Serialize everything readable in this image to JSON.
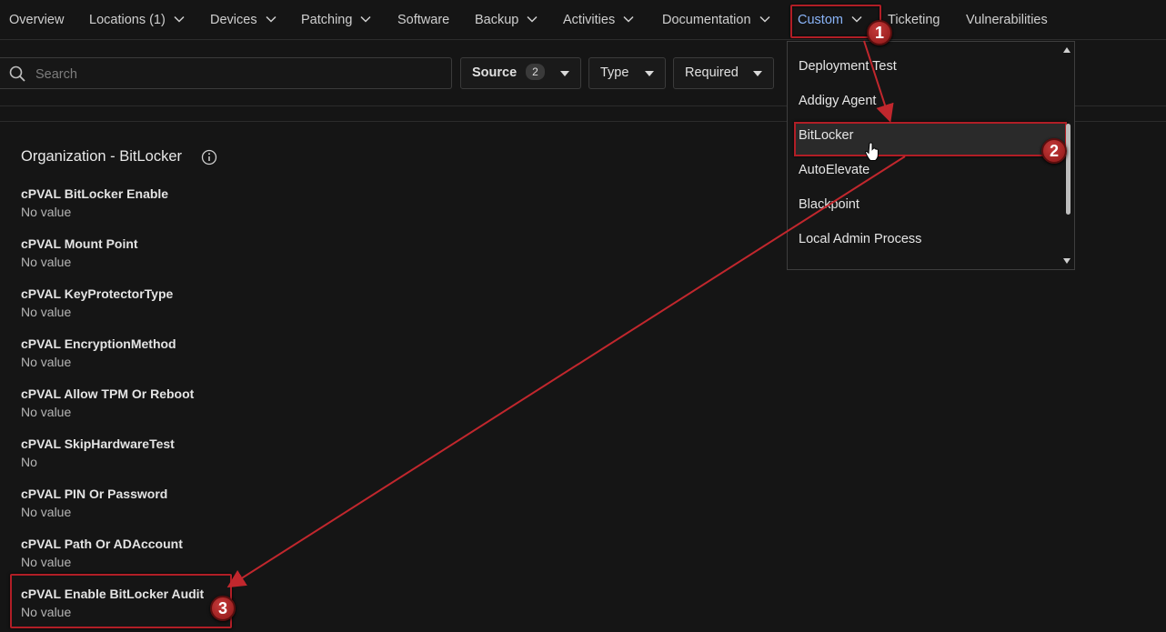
{
  "nav": {
    "items": [
      {
        "label": "Overview",
        "chevron": false
      },
      {
        "label": "Locations (1)",
        "chevron": true
      },
      {
        "label": "Devices",
        "chevron": true
      },
      {
        "label": "Patching",
        "chevron": true
      },
      {
        "label": "Software",
        "chevron": false
      },
      {
        "label": "Backup",
        "chevron": true
      },
      {
        "label": "Activities",
        "chevron": true
      },
      {
        "label": "Documentation",
        "chevron": true
      },
      {
        "label": "Custom",
        "chevron": true,
        "active": true
      },
      {
        "label": "Ticketing",
        "chevron": false
      },
      {
        "label": "Vulnerabilities",
        "chevron": false
      }
    ]
  },
  "filters": {
    "search_placeholder": "Search",
    "source_label": "Source",
    "source_count": "2",
    "type_label": "Type",
    "required_label": "Required"
  },
  "section": {
    "title": "Organization - BitLocker",
    "fields": [
      {
        "label": "cPVAL BitLocker Enable",
        "value": "No value"
      },
      {
        "label": "cPVAL Mount Point",
        "value": "No value"
      },
      {
        "label": "cPVAL KeyProtectorType",
        "value": "No value"
      },
      {
        "label": "cPVAL EncryptionMethod",
        "value": "No value"
      },
      {
        "label": "cPVAL Allow TPM Or Reboot",
        "value": "No value"
      },
      {
        "label": "cPVAL SkipHardwareTest",
        "value": "No"
      },
      {
        "label": "cPVAL PIN Or Password",
        "value": "No value"
      },
      {
        "label": "cPVAL Path Or ADAccount",
        "value": "No value"
      },
      {
        "label": "cPVAL Enable BitLocker Audit",
        "value": "No value"
      }
    ]
  },
  "dropdown": {
    "items": [
      "Deployment Test",
      "Addigy Agent",
      "BitLocker",
      "AutoElevate",
      "Blackpoint",
      "Local Admin Process"
    ],
    "selected": "BitLocker"
  },
  "markers": [
    "1",
    "2",
    "3"
  ],
  "colors": {
    "background": "#151515",
    "active_nav": "#8ab4f8",
    "annotation_red": "#b11e26"
  }
}
